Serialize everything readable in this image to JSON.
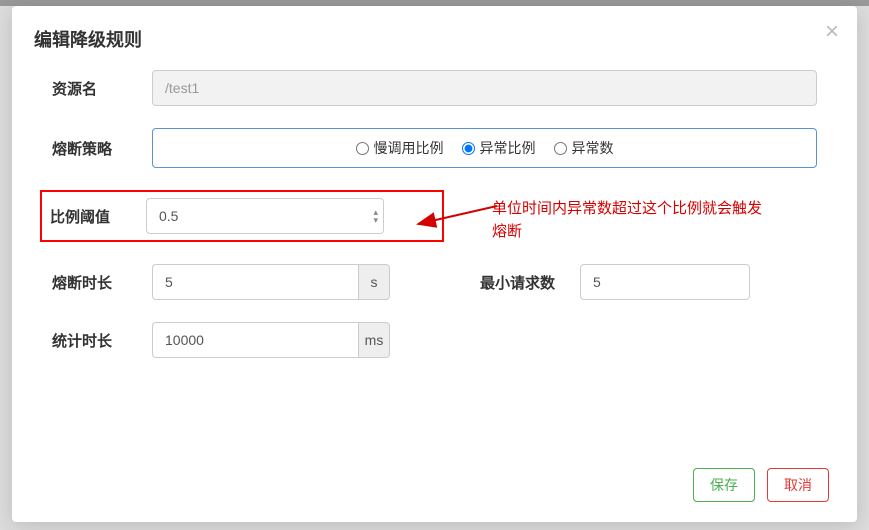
{
  "modal": {
    "title": "编辑降级规则"
  },
  "form": {
    "resource_label": "资源名",
    "resource_value": "/test1",
    "strategy_label": "熔断策略",
    "strategy_options": {
      "slow": "慢调用比例",
      "ratio": "异常比例",
      "count": "异常数"
    },
    "threshold_label": "比例阈值",
    "threshold_value": "0.5",
    "duration_label": "熔断时长",
    "duration_value": "5",
    "duration_unit": "s",
    "min_req_label": "最小请求数",
    "min_req_value": "5",
    "stat_label": "统计时长",
    "stat_value": "10000",
    "stat_unit": "ms"
  },
  "annotation": {
    "text": "单位时间内异常数超过这个比例就会触发熔断"
  },
  "footer": {
    "save": "保存",
    "cancel": "取消"
  }
}
